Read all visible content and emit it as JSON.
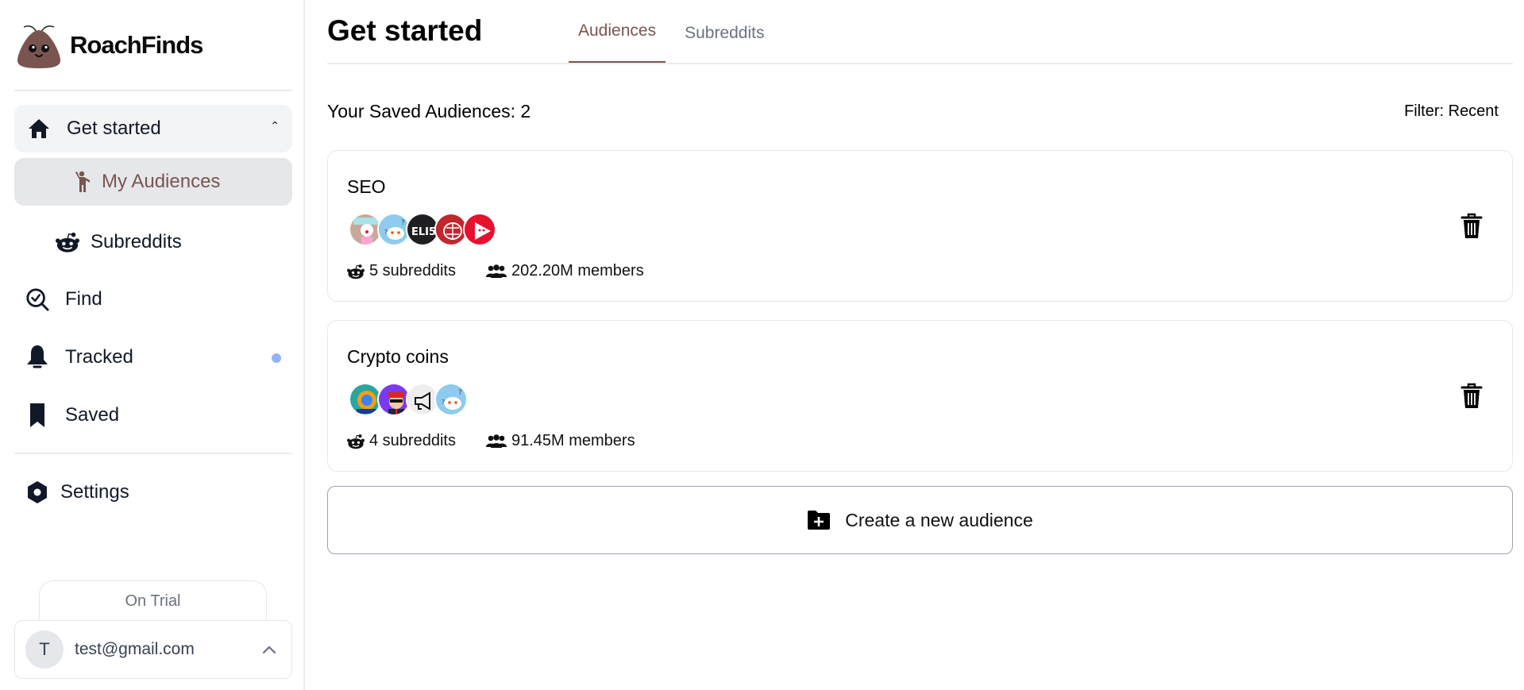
{
  "app": {
    "name": "RoachFinds",
    "accent": "#7a5550"
  },
  "sidebar": {
    "items": [
      {
        "label": "Get started",
        "icon": "home-icon",
        "expanded": true
      },
      {
        "label": "My Audiences",
        "icon": "person-waving-icon",
        "active": true
      },
      {
        "label": "Subreddits",
        "icon": "reddit-icon"
      },
      {
        "label": "Find",
        "icon": "search-check-icon"
      },
      {
        "label": "Tracked",
        "icon": "bell-icon",
        "has_notification": true
      },
      {
        "label": "Saved",
        "icon": "bookmark-icon"
      },
      {
        "label": "Settings",
        "icon": "hexagon-gear-icon"
      }
    ],
    "plan_badge": "On Trial",
    "user": {
      "initial": "T",
      "email": "test@gmail.com"
    }
  },
  "header": {
    "title": "Get started",
    "tabs": [
      {
        "label": "Audiences",
        "active": true
      },
      {
        "label": "Subreddits",
        "active": false
      }
    ]
  },
  "main": {
    "saved_count_label": "Your Saved Audiences: 2",
    "filter_label": "Filter: Recent",
    "audiences": [
      {
        "name": "SEO",
        "subreddit_count": "5 subreddits",
        "members": "202.20M members",
        "avatars": [
          {
            "kind": "cartoon",
            "bg": "#c8a89a"
          },
          {
            "kind": "snoo-question",
            "bg": "#8ecbef"
          },
          {
            "kind": "text-eli5",
            "bg": "#1f1f22",
            "text": "ELI5"
          },
          {
            "kind": "brain",
            "bg": "#c1272d"
          },
          {
            "kind": "play",
            "bg": "#e8112d"
          }
        ]
      },
      {
        "name": "Crypto coins",
        "subreddit_count": "4 subreddits",
        "members": "91.45M members",
        "avatars": [
          {
            "kind": "coin",
            "bg": "#2aa6a0"
          },
          {
            "kind": "character",
            "bg": "#7c3aed"
          },
          {
            "kind": "megaphone",
            "bg": "#eeeeee"
          },
          {
            "kind": "snoo-question",
            "bg": "#8ecbef"
          }
        ]
      }
    ],
    "create_label": "Create a new audience"
  }
}
